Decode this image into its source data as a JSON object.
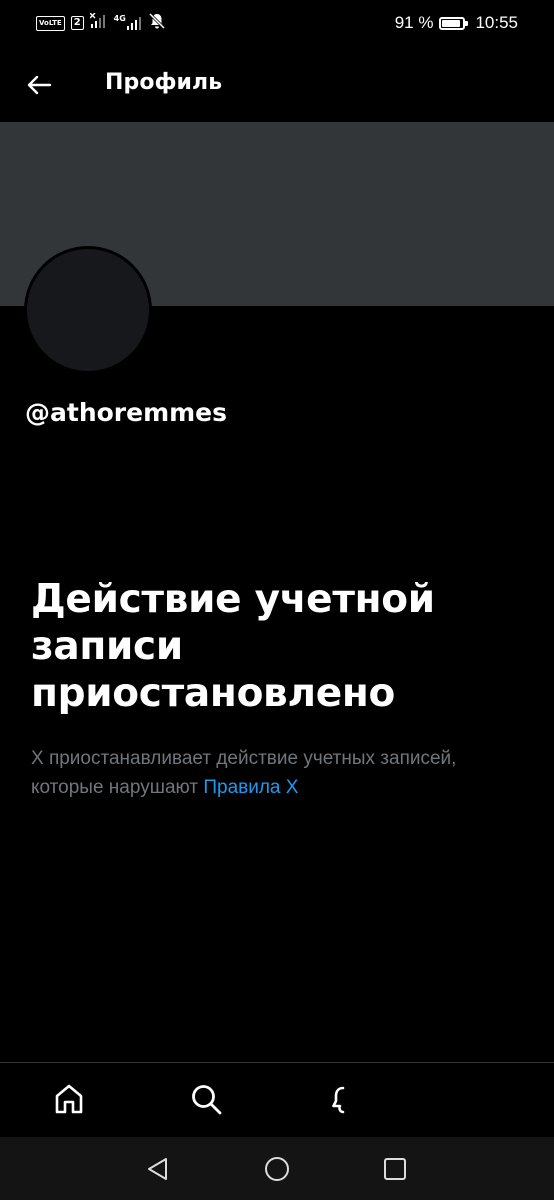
{
  "status_bar": {
    "volte_label": "VoLTE",
    "sim_label": "2",
    "network_label": "4G",
    "battery_label": "91 %",
    "battery_level": 0.91,
    "time": "10:55"
  },
  "header": {
    "title": "Профиль"
  },
  "profile": {
    "handle": "@athoremmes",
    "banner_color": "#333639"
  },
  "suspension": {
    "title": "Действие учетной записи приостановлено",
    "description": "X приостанавливает действие учетных записей, которые нарушают",
    "rules_link": "Правила X"
  },
  "tabs": [
    {
      "name": "home",
      "icon": "home-icon"
    },
    {
      "name": "search",
      "icon": "search-icon"
    },
    {
      "name": "notifications",
      "icon": "bell-icon"
    }
  ],
  "colors": {
    "background": "#000000",
    "link": "#1d9bf0",
    "secondary_text": "#71767b"
  }
}
